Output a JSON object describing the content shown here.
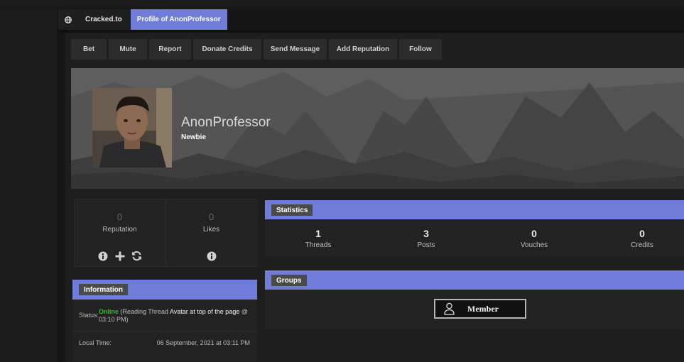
{
  "breadcrumb": {
    "home_icon": "globe-icon",
    "site": "Cracked.to",
    "current": "Profile of AnonProfessor"
  },
  "actions": [
    "Bet",
    "Mute",
    "Report",
    "Donate Credits",
    "Send Message",
    "Add Reputation",
    "Follow"
  ],
  "profile": {
    "username": "AnonProfessor",
    "usertitle": "Newbie"
  },
  "reputation": {
    "value": "0",
    "label": "Reputation"
  },
  "likes": {
    "value": "0",
    "label": "Likes"
  },
  "information": {
    "header": "Information",
    "status_label": "Status:",
    "status_online": "Online",
    "status_open": "(Reading Thread ",
    "status_thread": "Avatar at top of the page",
    "status_close": " @ 03:10 PM)",
    "local_time_label": "Local Time:",
    "local_time_value": "06 September, 2021 at 03:11 PM"
  },
  "statistics": {
    "header": "Statistics",
    "items": [
      {
        "value": "1",
        "label": "Threads"
      },
      {
        "value": "3",
        "label": "Posts"
      },
      {
        "value": "0",
        "label": "Vouches"
      },
      {
        "value": "0",
        "label": "Credits"
      }
    ]
  },
  "groups": {
    "header": "Groups",
    "badge": "Member"
  },
  "colors": {
    "accent": "#6f7cd8",
    "online": "#2fbf2f",
    "background": "#1c1c1c"
  }
}
